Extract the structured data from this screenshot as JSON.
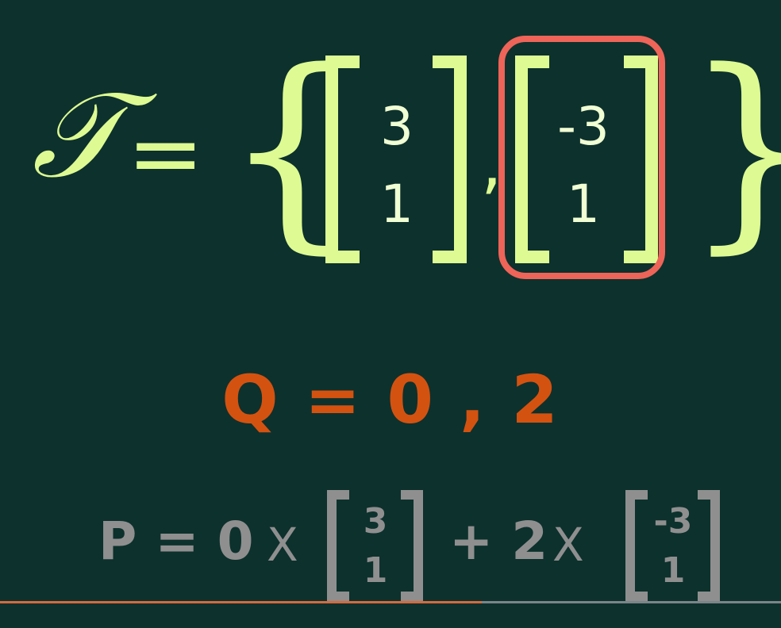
{
  "colors": {
    "background": "#0d312d",
    "top_text": "#ddfb92",
    "top_vector_text": "#f1ffd4",
    "highlight": "#ee6458",
    "q_text": "#d45210",
    "bottom_text": "#8f8f8f",
    "progress_fill": "#d56a3f",
    "progress_rest": "#7a8589"
  },
  "top_equation": {
    "symbol": "𝒯",
    "equals": "=",
    "left_brace": "{",
    "right_brace": "}",
    "comma": ",",
    "vector_1": [
      "3",
      "1"
    ],
    "vector_2": [
      "-3",
      "1"
    ]
  },
  "q_line": "Q = 0 , 2",
  "bottom_equation": {
    "p_label": "P = 0",
    "times_1": "X",
    "vector_1": [
      "3",
      "1"
    ],
    "plus_term": "+ 2",
    "times_2": "X",
    "vector_2": [
      "-3",
      "1"
    ]
  },
  "progress": {
    "fraction": 0.617
  }
}
